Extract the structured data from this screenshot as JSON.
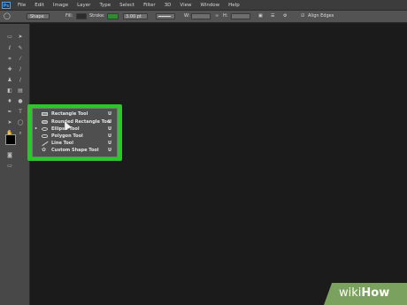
{
  "menubar": {
    "logo": "Ps",
    "items": [
      "File",
      "Edit",
      "Image",
      "Layer",
      "Type",
      "Select",
      "Filter",
      "3D",
      "View",
      "Window",
      "Help"
    ]
  },
  "options": {
    "mode": "Shape",
    "fill_label": "Fill:",
    "stroke_label": "Stroke:",
    "stroke_color": "#2e8b2e",
    "stroke_size": "3.00 pt",
    "w_label": "W:",
    "h_label": "H:",
    "align_edges": "Align Edges"
  },
  "flyout": {
    "items": [
      {
        "label": "Rectangle Tool",
        "key": "U",
        "icon": "rectangle-icon",
        "active": false
      },
      {
        "label": "Rounded Rectangle Tool",
        "key": "U",
        "icon": "rounded-rectangle-icon",
        "active": false
      },
      {
        "label": "Ellipse Tool",
        "key": "U",
        "icon": "ellipse-icon",
        "active": true
      },
      {
        "label": "Polygon Tool",
        "key": "U",
        "icon": "polygon-icon",
        "active": false
      },
      {
        "label": "Line Tool",
        "key": "U",
        "icon": "line-icon",
        "active": false
      },
      {
        "label": "Custom Shape Tool",
        "key": "U",
        "icon": "custom-shape-icon",
        "active": false
      }
    ],
    "bullet": "•",
    "highlight_color": "#22cc22"
  },
  "watermark": {
    "wiki": "wiki",
    "how": "How"
  }
}
